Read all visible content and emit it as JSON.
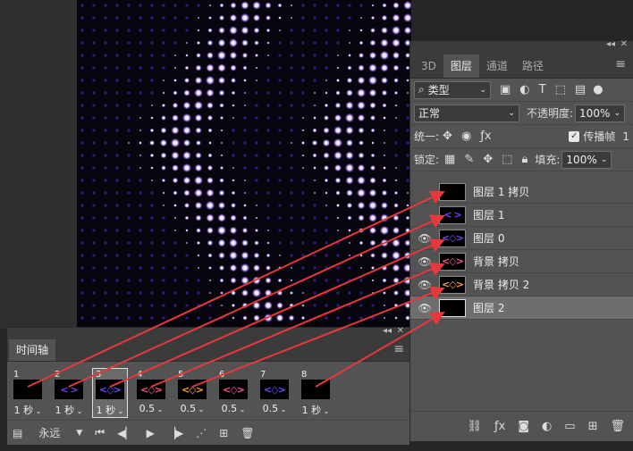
{
  "layers_panel": {
    "tabs": [
      "3D",
      "图层",
      "通道",
      "路径"
    ],
    "active_tab": "图层",
    "filter_label": "类型",
    "blend_mode": "正常",
    "opacity_label": "不透明度:",
    "opacity_value": "100%",
    "unify_label": "统一:",
    "propagate_label": "传播帧",
    "propagate_value": "1",
    "lock_label": "锁定:",
    "fill_label": "填充:",
    "fill_value": "100%",
    "layers": [
      {
        "name": "图层 1 拷贝",
        "visible": false,
        "thumb_color": "#000000",
        "thumb_glyph": ""
      },
      {
        "name": "图层 1",
        "visible": false,
        "thumb_color": "#7a3cff",
        "thumb_glyph": "<  >"
      },
      {
        "name": "图层 0",
        "visible": true,
        "thumb_color": "#6a4cff",
        "thumb_glyph": "<◇>"
      },
      {
        "name": "背景 拷贝",
        "visible": true,
        "thumb_color": "#ff4f9a",
        "thumb_glyph": "<◇>"
      },
      {
        "name": "背景 拷贝 2",
        "visible": true,
        "thumb_color": "#ffa030",
        "thumb_glyph": "<◇>"
      },
      {
        "name": "图层 2",
        "visible": true,
        "thumb_color": "#000000",
        "thumb_glyph": ""
      }
    ]
  },
  "timeline": {
    "title": "时间轴",
    "loop_option": "永远",
    "frames": [
      {
        "number": "1",
        "delay": "1 秒",
        "thumb_color": "#000000",
        "thumb_glyph": ""
      },
      {
        "number": "2",
        "delay": "1 秒",
        "thumb_color": "#7a3cff",
        "thumb_glyph": "<  >"
      },
      {
        "number": "3",
        "delay": "1 秒",
        "thumb_color": "#6a4cff",
        "thumb_glyph": "<◇>"
      },
      {
        "number": "4",
        "delay": "0.5",
        "thumb_color": "#ff4f9a",
        "thumb_glyph": "<◇>"
      },
      {
        "number": "5",
        "delay": "0.5",
        "thumb_color": "#ffa030",
        "thumb_glyph": "<◇>"
      },
      {
        "number": "6",
        "delay": "0.5",
        "thumb_color": "#ff4f9a",
        "thumb_glyph": "<◇>"
      },
      {
        "number": "7",
        "delay": "0.5",
        "thumb_color": "#6a4cff",
        "thumb_glyph": "<◇>"
      },
      {
        "number": "8",
        "delay": "1 秒",
        "thumb_color": "#000000",
        "thumb_glyph": ""
      }
    ]
  },
  "colors": {
    "accent_arrow": "#e8383b",
    "glow": "#8a4dff"
  }
}
